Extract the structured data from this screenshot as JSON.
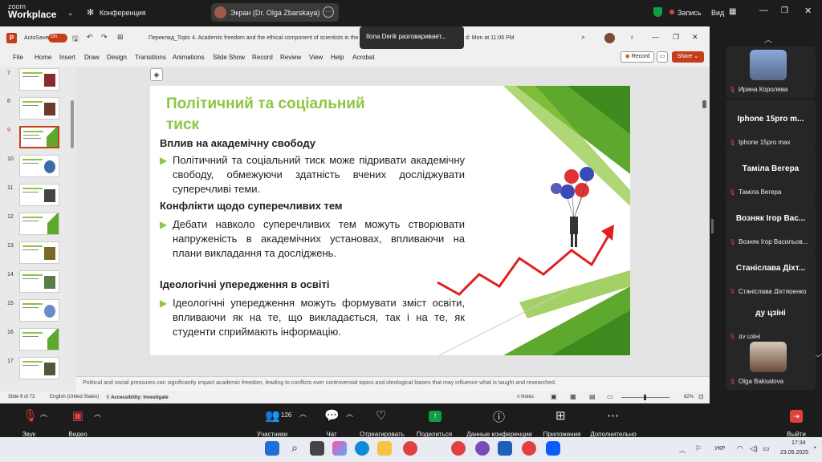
{
  "zoom": {
    "brand_line1": "zoom",
    "brand_line2": "Workplace",
    "meeting_label": "Конференция",
    "screen_share_title": "Экран (Dr. Olga Zbarskaya)",
    "recording_label": "Запись",
    "view_label": "Вид"
  },
  "tooltip": "Ilona Derik разговаривает...",
  "ppt": {
    "autosave_label": "AutoSave",
    "autosave_state": "On",
    "doc_title": "Переклад_Topic 4. Academic freedom and the ethical component of scientists in the U",
    "saved_label": "d: Mon at 11:06 PM",
    "menu": [
      "File",
      "Home",
      "Insert",
      "Draw",
      "Design",
      "Transitions",
      "Animations",
      "Slide Show",
      "Record",
      "Review",
      "View",
      "Help",
      "Acrobat"
    ],
    "record_btn": "Record",
    "share_btn": "Share",
    "thumb_numbers": [
      "7",
      "8",
      "9",
      "10",
      "11",
      "12",
      "13",
      "14",
      "15",
      "16",
      "17"
    ],
    "status_slide": "Slide 9 of 73",
    "status_lang": "English (United States)",
    "status_access": "Accessibility: Investigate",
    "status_notes": "Notes",
    "status_zoom": "82%",
    "notes_text": "Political and social pressures can significantly impact academic freedom, leading to conflicts over controversial topics and ideological biases that may influence what is taught and researched."
  },
  "slide": {
    "title_line1": "Політичний та соціальний",
    "title_line2": "тиск",
    "h1": "Вплив на академічну свободу",
    "b1": "Політичний та соціальний тиск може підривати академічну свободу, обмежуючи здатність вчених досліджувати суперечливі теми.",
    "h2": "Конфлікти щодо суперечливих тем",
    "b2": "Дебати навколо суперечливих тем можуть створювати напруженість в академічних установах, впливаючи на плани викладання та досліджень.",
    "h3": "Ідеологічні упередження в освіті",
    "b3": "Ідеологічні упередження можуть формувати зміст освіти, впливаючи як на те, що викладається, так і на те, як студенти сприймають інформацію."
  },
  "participants": [
    {
      "name": "Ирина Королева",
      "type": "photo"
    },
    {
      "name": "Iphone 15pro max",
      "big": "Iphone 15pro m..."
    },
    {
      "name": "Таміла Вегера",
      "big": "Таміла Вегера"
    },
    {
      "name": "Возняк Ігор Васильов...",
      "big": "Возняк Ігор Вас..."
    },
    {
      "name": "Станіслава Діхтяренко",
      "big": "Станіслава Діхт..."
    },
    {
      "name": "ду цзіні",
      "big": "ду цзіні"
    },
    {
      "name": "Olga Baksalova",
      "type": "photo"
    }
  ],
  "controls": {
    "audio": "Звук",
    "video": "Видео",
    "participants": "Участники",
    "participants_count": "126",
    "chat": "Чат",
    "react": "Отреагировать",
    "share": "Поделиться",
    "info": "Данные конференции",
    "apps": "Приложения",
    "more": "Дополнительно",
    "leave": "Выйти"
  },
  "taskbar": {
    "lang": "УКР",
    "time": "17:34",
    "date": "23.05.2025"
  },
  "colors": {
    "accent_green": "#8dc63f",
    "ppt_red": "#c43e1c",
    "zoom_green": "#0e9f47"
  }
}
